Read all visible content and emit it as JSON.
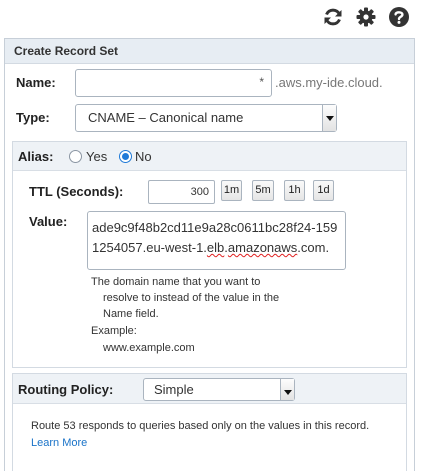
{
  "toolbar": {
    "icons": [
      "refresh-icon",
      "gear-icon",
      "help-icon"
    ]
  },
  "panel": {
    "title": "Create Record Set"
  },
  "name_field": {
    "label": "Name:",
    "value": "",
    "required_marker": "*",
    "suffix": ".aws.my-ide.cloud."
  },
  "type_field": {
    "label": "Type:",
    "selected": "CNAME – Canonical name"
  },
  "alias": {
    "label": "Alias:",
    "options": [
      "Yes",
      "No"
    ],
    "selected": "No"
  },
  "ttl": {
    "label": "TTL (Seconds):",
    "value": "300",
    "presets": [
      "1m",
      "5m",
      "1h",
      "1d"
    ]
  },
  "value_field": {
    "label": "Value:",
    "text_part1": "ade9c9f48b2cd11e9a28c0611bc28f24-1591254057.eu-west-1.",
    "text_elb": "elb",
    "text_part2": ".",
    "text_amazonaws": "amazonaws",
    "text_part3": ".com.",
    "help_line1": "The domain name that you want to",
    "help_line2": "resolve to instead of the value in the",
    "help_line3": "Name field.",
    "example_label": "Example:",
    "example_value": "www.example.com"
  },
  "routing": {
    "label": "Routing Policy:",
    "selected": "Simple",
    "description": "Route 53 responds to queries based only on the values in this record.",
    "learn_more": "Learn More"
  },
  "colors": {
    "accent": "#1f7ad8",
    "header_bg": "#e7edf3",
    "link": "#1a73c8"
  }
}
